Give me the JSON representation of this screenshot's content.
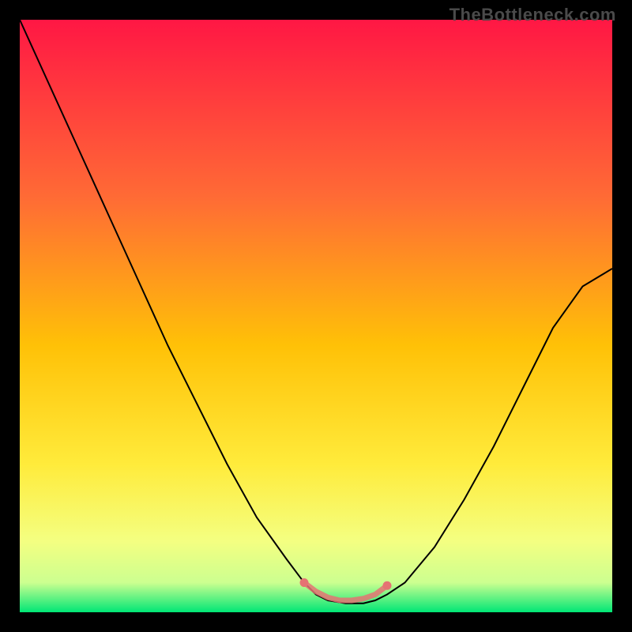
{
  "watermark": "TheBottleneck.com",
  "chart_data": {
    "type": "line",
    "title": "",
    "xlabel": "",
    "ylabel": "",
    "xlim": [
      0,
      100
    ],
    "ylim": [
      0,
      100
    ],
    "background_gradient": {
      "stops": [
        {
          "offset": 0,
          "color": "#ff1744"
        },
        {
          "offset": 30,
          "color": "#ff6b35"
        },
        {
          "offset": 55,
          "color": "#ffc107"
        },
        {
          "offset": 75,
          "color": "#ffeb3b"
        },
        {
          "offset": 88,
          "color": "#f4ff81"
        },
        {
          "offset": 95,
          "color": "#ccff90"
        },
        {
          "offset": 100,
          "color": "#00e676"
        }
      ]
    },
    "series": [
      {
        "name": "bottleneck-curve",
        "type": "line",
        "color": "#000000",
        "x": [
          0,
          5,
          10,
          15,
          20,
          25,
          30,
          35,
          40,
          45,
          48,
          50,
          52,
          55,
          58,
          60,
          62,
          65,
          70,
          75,
          80,
          85,
          90,
          95,
          100
        ],
        "y": [
          100,
          89,
          78,
          67,
          56,
          45,
          35,
          25,
          16,
          9,
          5,
          3,
          2,
          1.5,
          1.5,
          2,
          3,
          5,
          11,
          19,
          28,
          38,
          48,
          55,
          58
        ]
      },
      {
        "name": "optimal-range-marker",
        "type": "scatter",
        "color": "#e57373",
        "x": [
          48,
          50,
          52,
          54,
          56,
          58,
          60,
          62
        ],
        "y": [
          5,
          3.5,
          2.5,
          2,
          2,
          2.3,
          3,
          4.5
        ]
      }
    ]
  }
}
